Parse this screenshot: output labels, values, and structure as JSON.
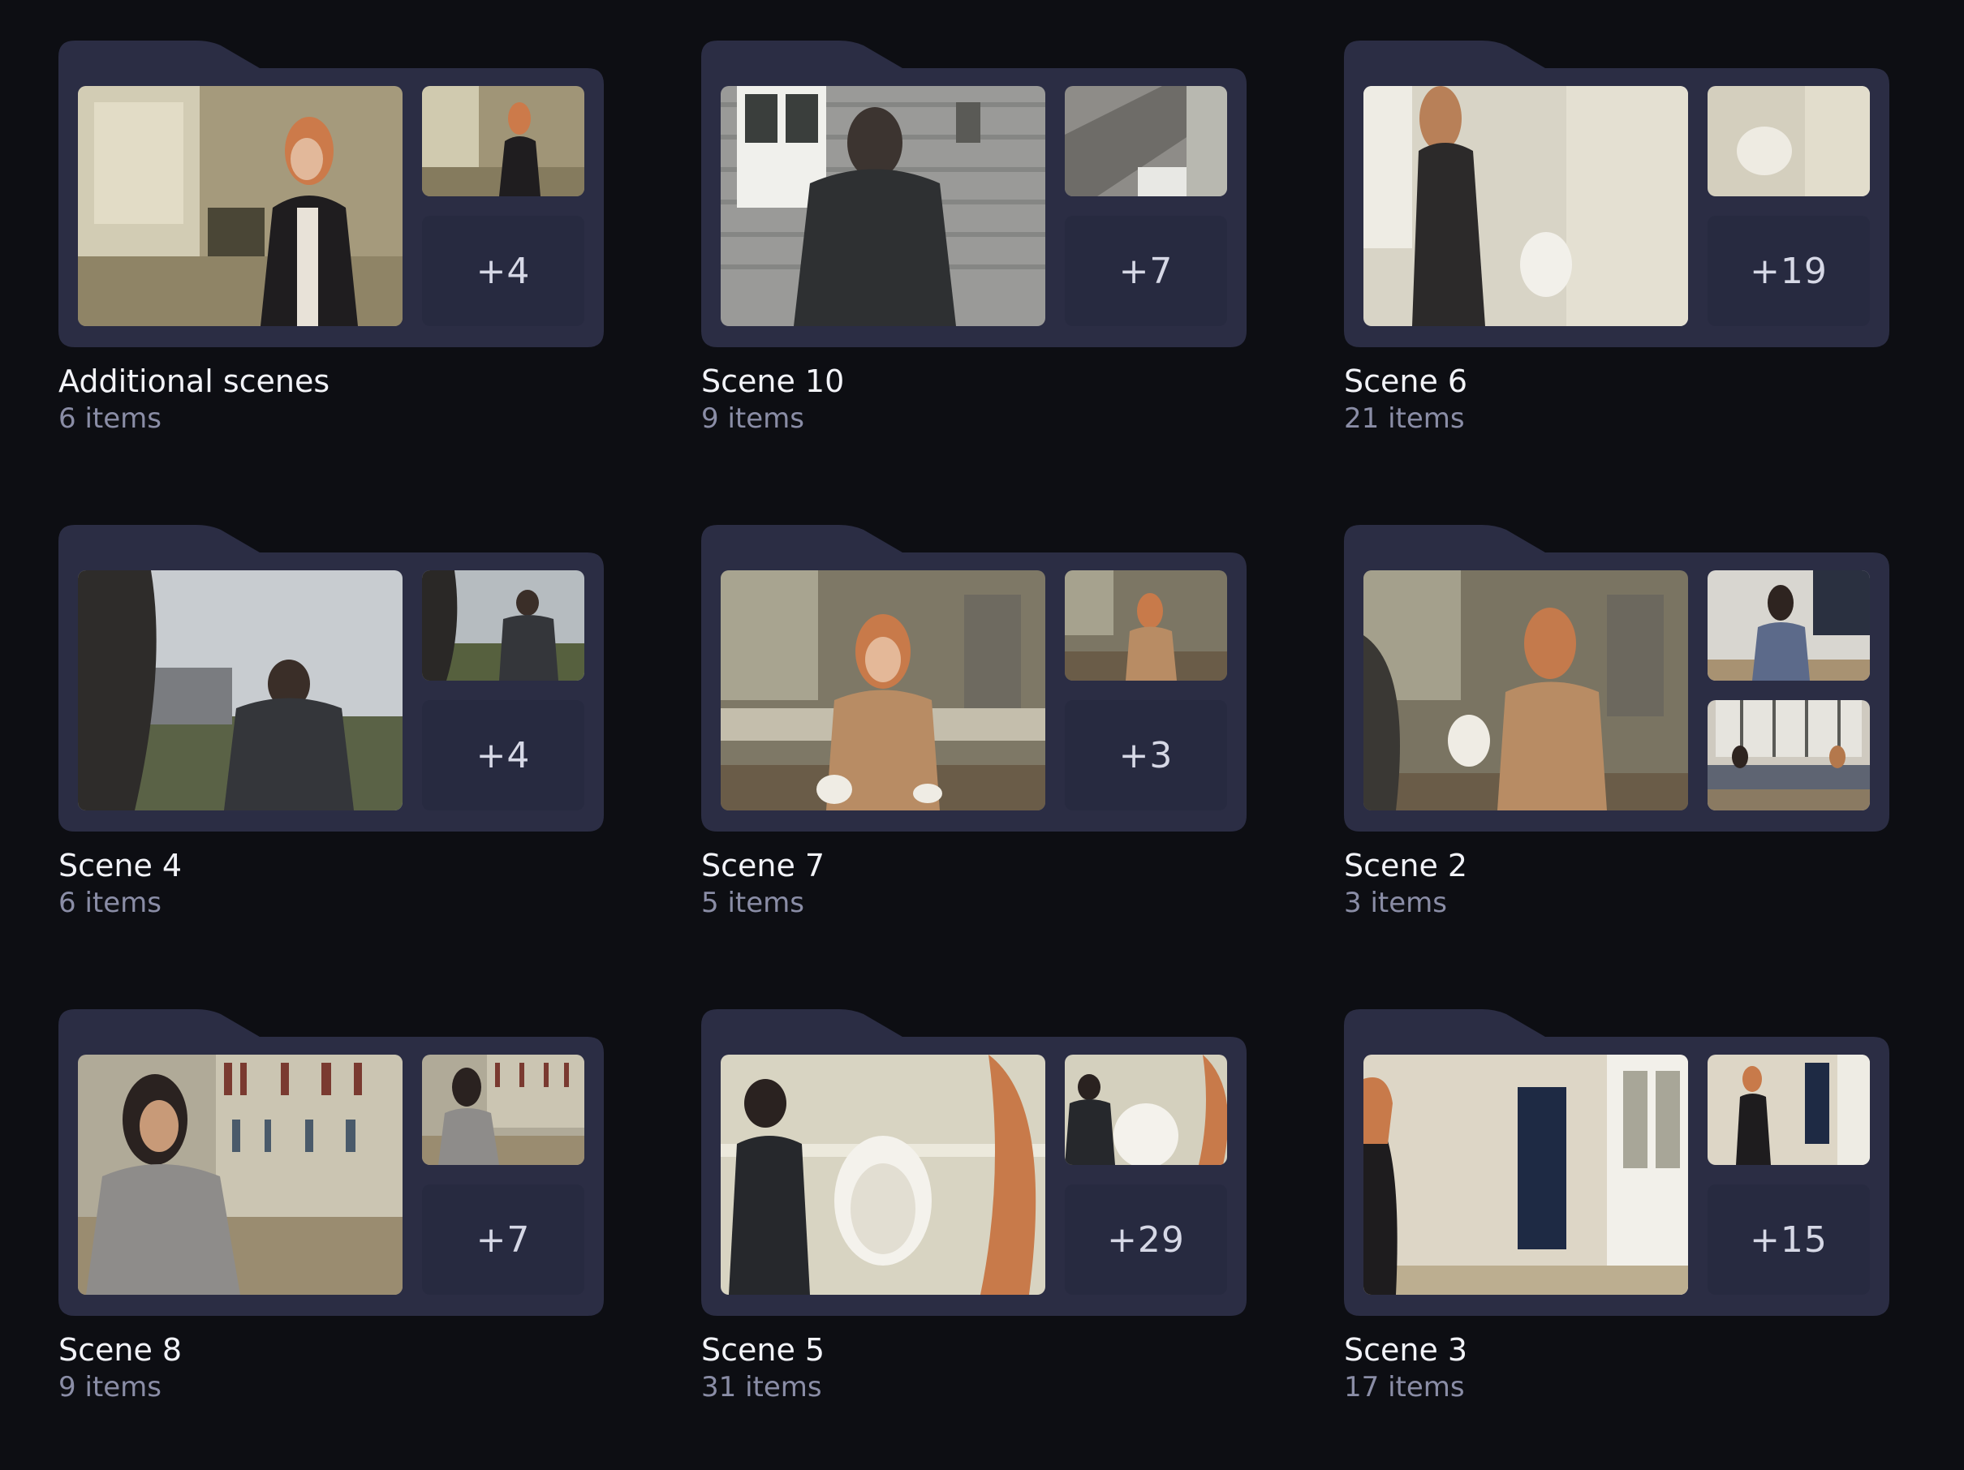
{
  "colors": {
    "background": "#0d0e13",
    "folder": "#2b2d44",
    "count_box": "#272a40",
    "title_text": "#f2f3f8",
    "subtitle_text": "#8a8da6"
  },
  "folders": [
    {
      "title": "Additional scenes",
      "subtitle": "6 items",
      "more": "+4"
    },
    {
      "title": "Scene 10",
      "subtitle": "9 items",
      "more": "+7"
    },
    {
      "title": "Scene 6",
      "subtitle": "21 items",
      "more": "+19"
    },
    {
      "title": "Scene 4",
      "subtitle": "6 items",
      "more": "+4"
    },
    {
      "title": "Scene 7",
      "subtitle": "5 items",
      "more": "+3"
    },
    {
      "title": "Scene 2",
      "subtitle": "3 items",
      "more": ""
    },
    {
      "title": "Scene 8",
      "subtitle": "9 items",
      "more": "+7"
    },
    {
      "title": "Scene 5",
      "subtitle": "31 items",
      "more": "+29"
    },
    {
      "title": "Scene 3",
      "subtitle": "17 items",
      "more": "+15"
    }
  ]
}
